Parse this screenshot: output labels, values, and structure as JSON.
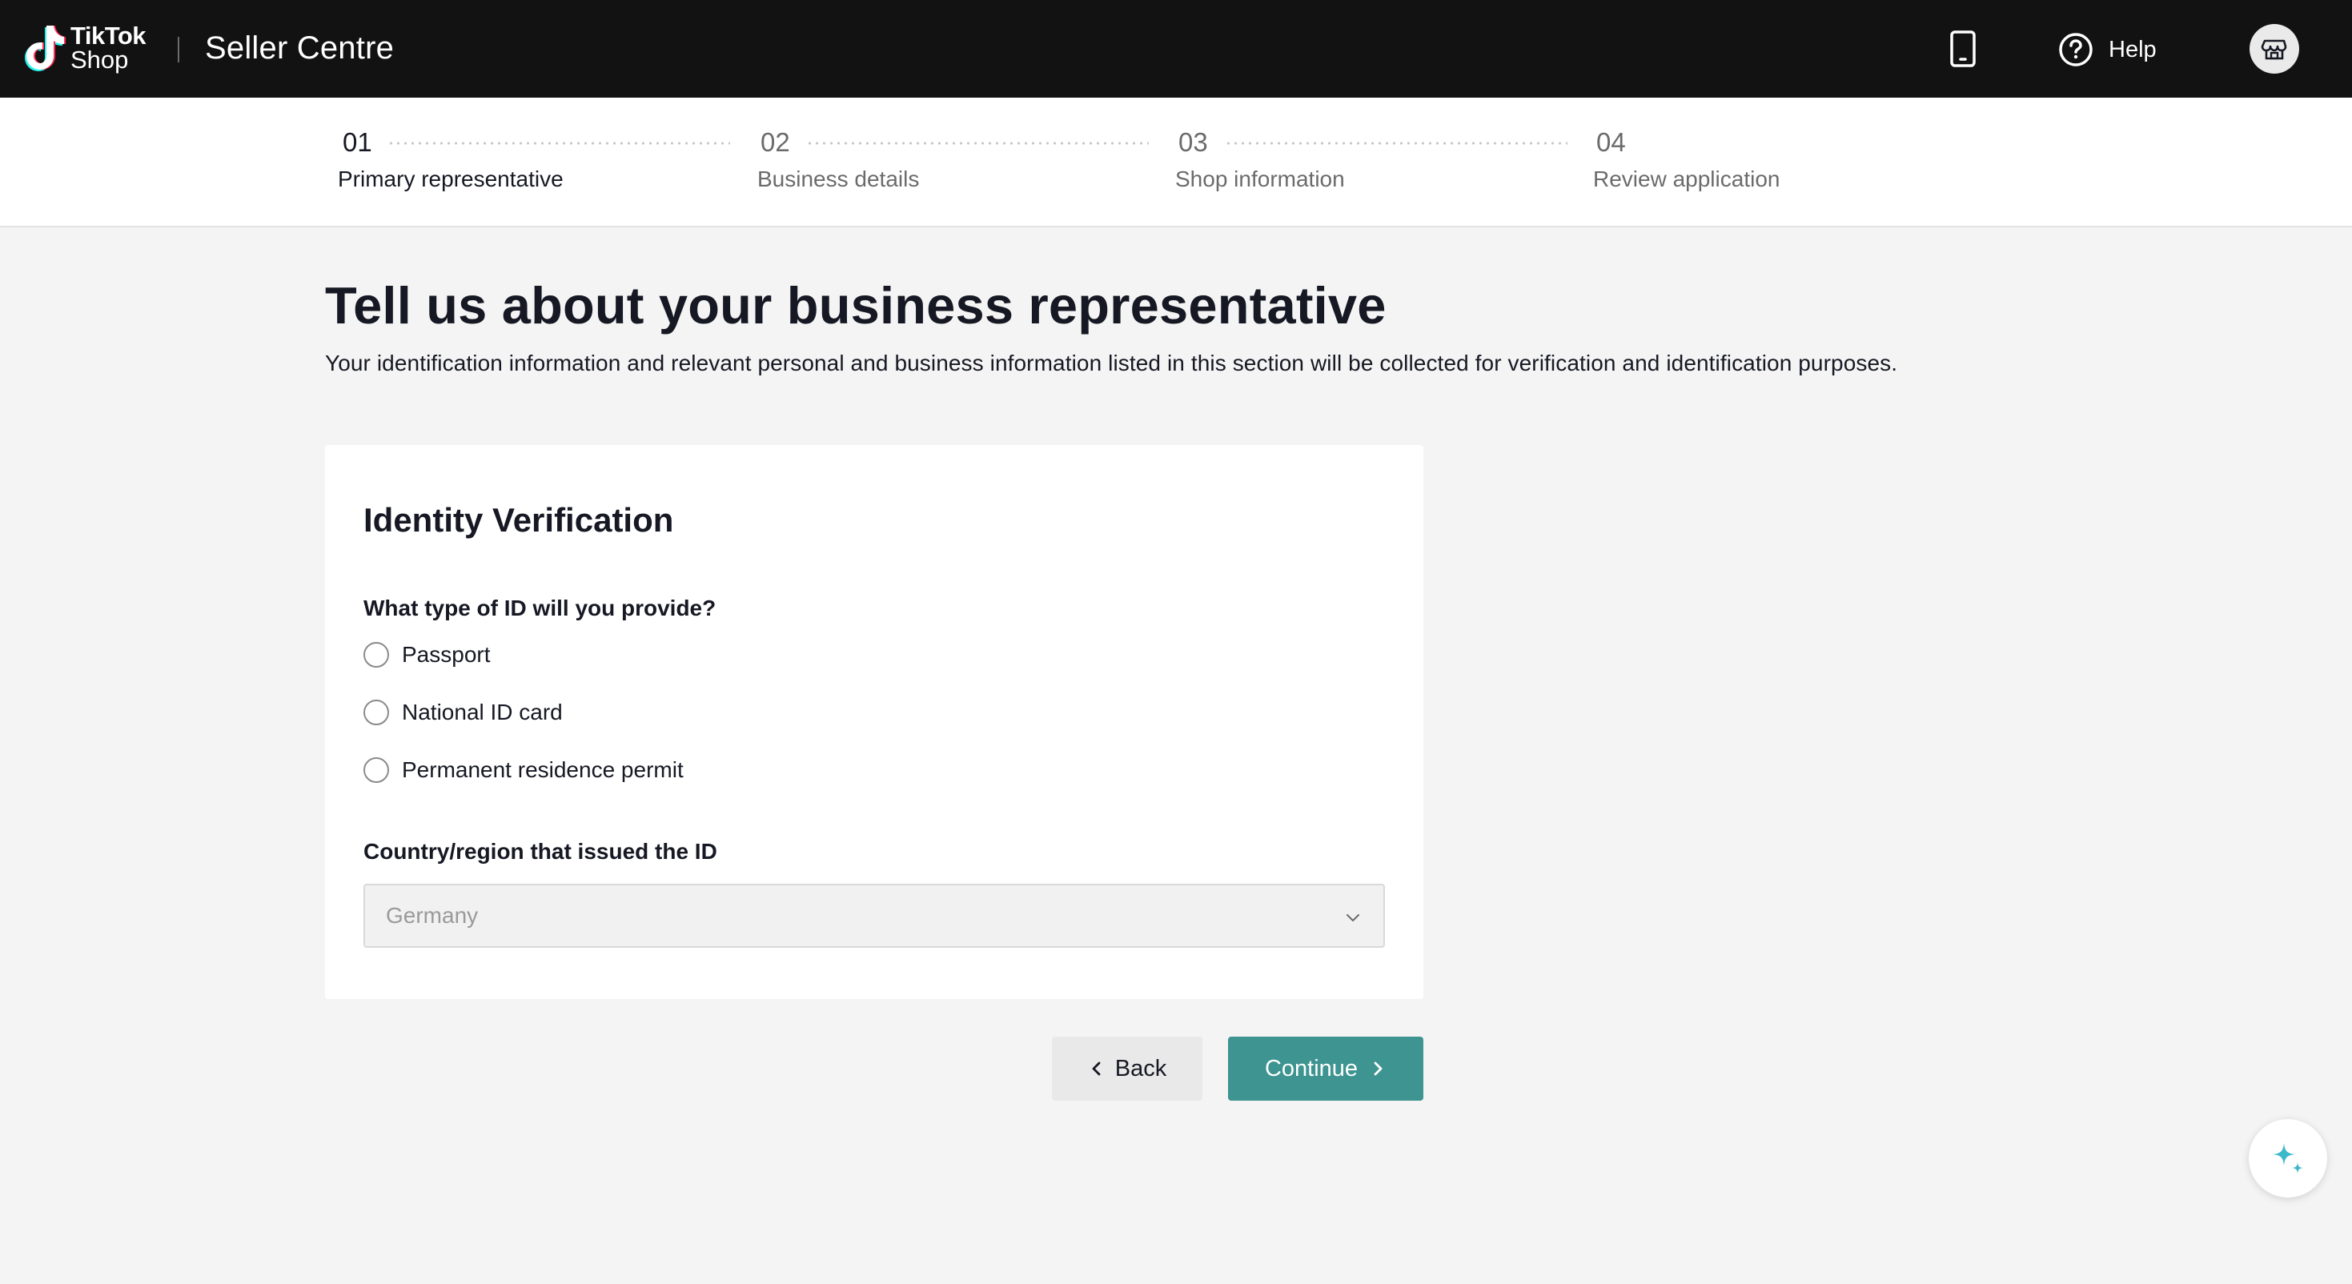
{
  "header": {
    "logo_line1": "TikTok",
    "logo_line2": "Shop",
    "app_title": "Seller Centre",
    "help_label": "Help",
    "icons": [
      "tiktok-logo-icon",
      "mobile-phone-icon",
      "help-circle-icon",
      "store-icon"
    ]
  },
  "stepper": {
    "steps": [
      {
        "number": "01",
        "label": "Primary representative",
        "state": "active"
      },
      {
        "number": "02",
        "label": "Business details",
        "state": "inactive"
      },
      {
        "number": "03",
        "label": "Shop information",
        "state": "inactive"
      },
      {
        "number": "04",
        "label": "Review application",
        "state": "inactive"
      }
    ]
  },
  "main": {
    "title": "Tell us about your business representative",
    "description": "Your identification information and relevant personal and business information listed in this section will be collected for verification and identification purposes."
  },
  "identity_card": {
    "title": "Identity Verification",
    "id_type_question": "What type of ID will you provide?",
    "id_options": [
      {
        "label": "Passport",
        "selected": false
      },
      {
        "label": "National ID card",
        "selected": false
      },
      {
        "label": "Permanent residence permit",
        "selected": false
      }
    ],
    "country_label": "Country/region that issued the ID",
    "country_value": "Germany"
  },
  "actions": {
    "back_label": "Back",
    "continue_label": "Continue"
  },
  "colors": {
    "topbar_bg": "#121212",
    "page_bg": "#f4f4f4",
    "primary_button": "#3d9491",
    "ai_sparkle": "#3bb8c9"
  }
}
